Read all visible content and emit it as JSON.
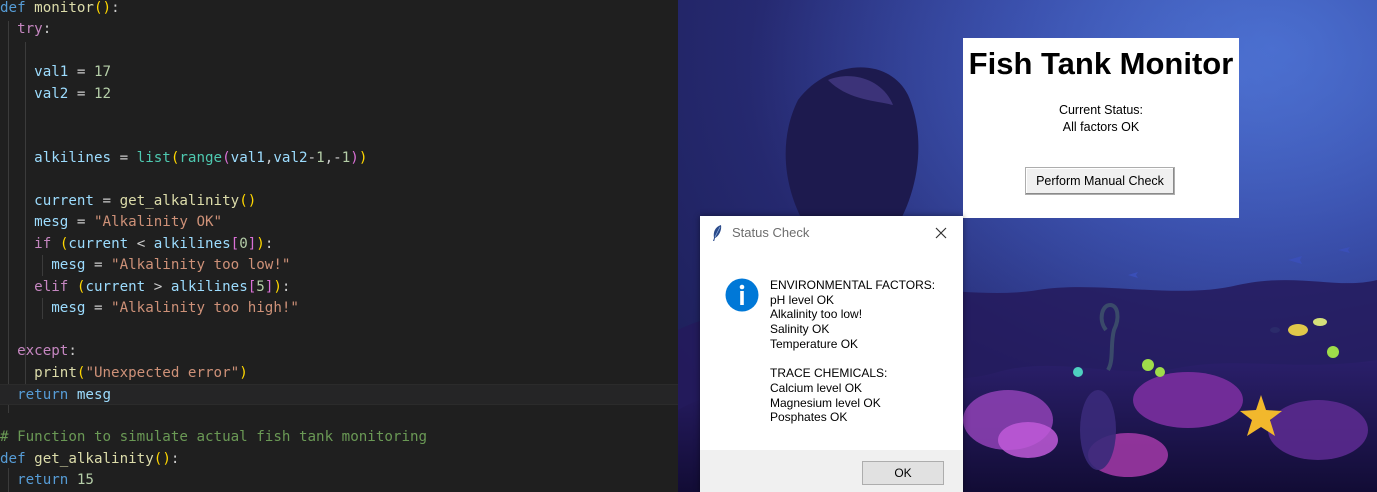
{
  "editor": {
    "lines": [
      "def monitor():",
      "  try:",
      "",
      "    val1 = 17",
      "    val2 = 12",
      "",
      "",
      "    alkilines = list(range(val1,val2-1,-1))",
      "",
      "    current = get_alkalinity()",
      "    mesg = \"Alkalinity OK\"",
      "    if (current < alkilines[0]):",
      "      mesg = \"Alkalinity too low!\"",
      "    elif (current > alkilines[5]):",
      "      mesg = \"Alkalinity too high!\"",
      "",
      "  except:",
      "    print(\"Unexpected error\")",
      "  return mesg",
      "",
      "# Function to simulate actual fish tank monitoring",
      "def get_alkalinity():",
      "  return 15"
    ]
  },
  "app": {
    "title": "Fish Tank Monitor",
    "status_heading": "Current Status:",
    "status_value": "All factors OK",
    "manual_check_label": "Perform Manual Check"
  },
  "dialog": {
    "title": "Status Check",
    "icon": "info-icon",
    "message_lines": [
      "ENVIRONMENTAL FACTORS:",
      "pH level OK",
      "Alkalinity too low!",
      "Salinity OK",
      "Temperature OK",
      "",
      "TRACE CHEMICALS:",
      "Calcium level OK",
      "Magnesium level OK",
      "Posphates OK"
    ],
    "ok_label": "OK"
  },
  "colors": {
    "editor_bg": "#1f1f1f",
    "keyword": "#569cd6",
    "control": "#c586c0",
    "function": "#dcdcaa",
    "variable": "#9cdcfe",
    "number": "#b5cea8",
    "string": "#ce9178",
    "comment": "#6a9955",
    "info_blue": "#0078d7"
  }
}
